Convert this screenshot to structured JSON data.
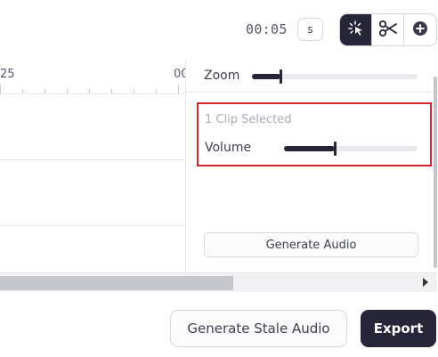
{
  "header": {
    "time_display": "00:05",
    "unit_label": "s",
    "tools": [
      {
        "name": "select-tool",
        "icon": "cursor-sparkle-icon",
        "active": true
      },
      {
        "name": "cut-tool",
        "icon": "scissors-icon",
        "active": false
      },
      {
        "name": "add-tool",
        "icon": "plus-circle-icon",
        "active": false
      }
    ]
  },
  "timeline": {
    "ruler_labels": [
      "25",
      "00"
    ]
  },
  "panel": {
    "zoom_label": "Zoom",
    "zoom_level": 0.17,
    "selection_text": "1 Clip Selected",
    "volume_label": "Volume",
    "volume_level": 0.38,
    "generate_audio_label": "Generate Audio"
  },
  "actions": {
    "stale_label": "Generate Stale Audio",
    "export_label": "Export"
  },
  "colors": {
    "accent": "#262638",
    "highlight": "#d6222a"
  }
}
